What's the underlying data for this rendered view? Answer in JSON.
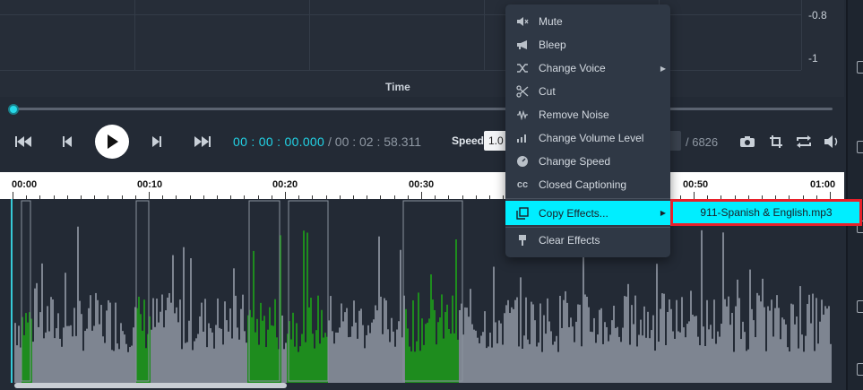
{
  "chart": {
    "y_labels": [
      "-0.8",
      "-1"
    ],
    "x_title": "Time"
  },
  "player": {
    "current_time": "00 : 00 : 00.000",
    "total_time": "/ 00 : 02 : 58.311",
    "speed_label": "Speed",
    "speed_value": "1.0",
    "frame_total": "/ 6826",
    "seek_position": 0.0
  },
  "timeline": {
    "ticks": [
      "00:00",
      "00:10",
      "00:20",
      "00:30",
      "00:50",
      "01:00"
    ]
  },
  "context_menu": {
    "items": [
      {
        "label": "Mute",
        "icon": "mute-icon"
      },
      {
        "label": "Bleep",
        "icon": "megaphone-icon"
      },
      {
        "label": "Change Voice",
        "icon": "shuffle-icon",
        "submenu": true
      },
      {
        "label": "Cut",
        "icon": "scissors-icon"
      },
      {
        "label": "Remove Noise",
        "icon": "noise-icon"
      },
      {
        "label": "Change Volume Level",
        "icon": "volume-level-icon"
      },
      {
        "label": "Change Speed",
        "icon": "speedometer-icon"
      },
      {
        "label": "Closed Captioning",
        "icon": "cc-icon"
      },
      {
        "label": "Copy Effects...",
        "icon": "copy-icon",
        "submenu": true,
        "active": true
      },
      {
        "label": "Clear Effects",
        "icon": "brush-icon"
      }
    ]
  },
  "submenu": {
    "items": [
      "911-Spanish & English.mp3"
    ]
  },
  "colors": {
    "accent": "#00eeff",
    "waveform": "#7e8591",
    "waveform_effect": "#1e8c1e",
    "highlight_border": "#e8202a"
  }
}
